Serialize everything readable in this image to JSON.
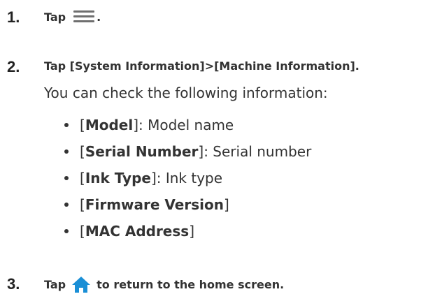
{
  "steps": [
    {
      "number": "1.",
      "text_before": "Tap",
      "icon": "menu-icon",
      "text_after": "."
    },
    {
      "number": "2.",
      "text": "Tap [System Information]>[Machine Information]."
    },
    {
      "number": "3.",
      "text_before": "Tap",
      "icon": "home-icon",
      "text_after": "to return to the home screen."
    }
  ],
  "description": "You can check the following information:",
  "items": [
    {
      "open": "[",
      "label": "Model",
      "close": "]",
      "rest": ": Model name"
    },
    {
      "open": "[",
      "label": "Serial Number",
      "close": "]",
      "rest": ": Serial number"
    },
    {
      "open": "[",
      "label": "Ink Type",
      "close": "]",
      "rest": ": Ink type"
    },
    {
      "open": "[",
      "label": "Firmware Version",
      "close": "]",
      "rest": ""
    },
    {
      "open": "[",
      "label": "MAC Address",
      "close": "]",
      "rest": ""
    }
  ],
  "colors": {
    "text": "#333333",
    "icon": "#6f6f6f",
    "home_icon": "#1a8fd6"
  }
}
